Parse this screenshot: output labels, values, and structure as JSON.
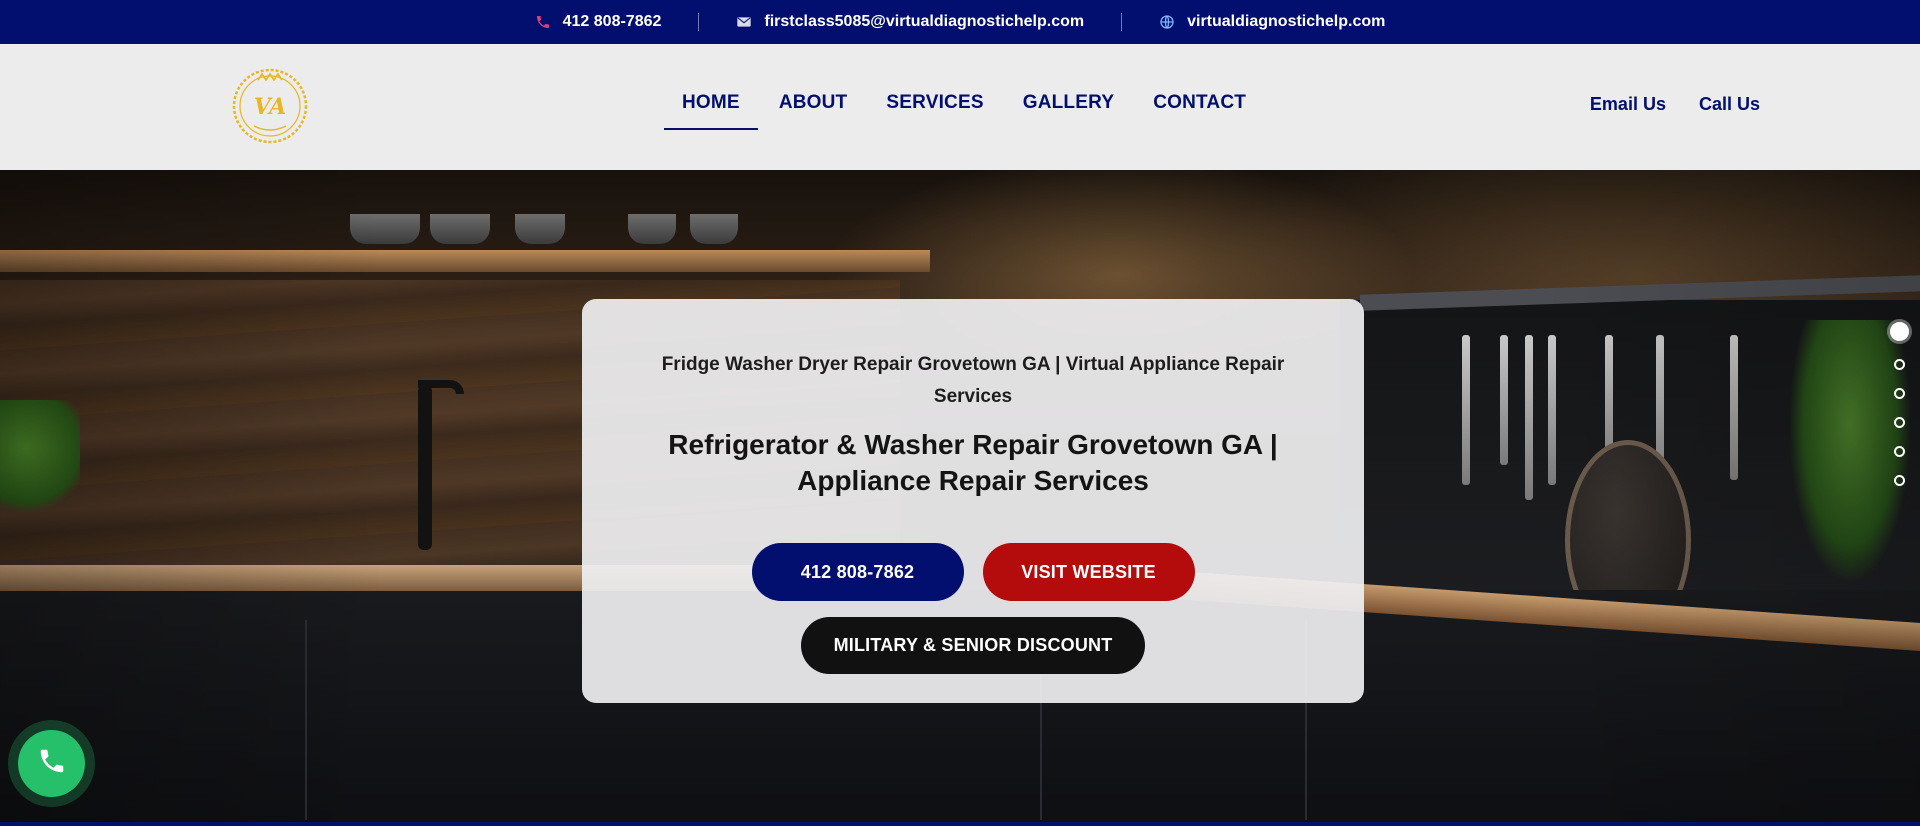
{
  "topbar": {
    "phone": "412 808-7862",
    "email": "firstclass5085@virtualdiagnostichelp.com",
    "website": "virtualdiagnostichelp.com",
    "icons": [
      "phone-icon",
      "mail-icon",
      "globe-icon"
    ],
    "background": "#020f6e",
    "phone_icon_color": "#e23b7a"
  },
  "header": {
    "logo_initials": "VA",
    "nav": [
      "HOME",
      "ABOUT",
      "SERVICES",
      "GALLERY",
      "CONTACT"
    ],
    "active_nav": "HOME",
    "links": [
      "Email Us",
      "Call Us"
    ],
    "accent": "#020f6e",
    "logo_color": "#e7b722"
  },
  "hero": {
    "subtitle": "Fridge Washer Dryer Repair Grovetown GA | Virtual Appliance Repair Services",
    "title": "Refrigerator & Washer Repair Grovetown GA | Appliance Repair Services",
    "phone_button": "412 808-7862",
    "visit_button": "VISIT WEBSITE",
    "discount_button": "MILITARY & SENIOR DISCOUNT",
    "button_colors": {
      "phone": "#020f6e",
      "visit": "#b40c0c",
      "discount": "#111111"
    },
    "slides_total": 6,
    "active_slide": 1
  },
  "floating_call": {
    "icon": "phone-icon",
    "color": "#26c06a"
  }
}
